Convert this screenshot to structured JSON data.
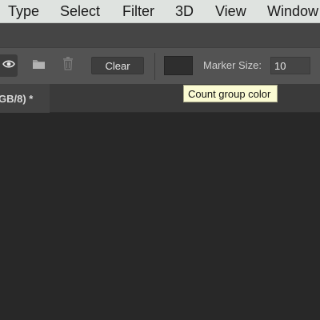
{
  "menubar": {
    "items": [
      "Type",
      "Select",
      "Filter",
      "3D",
      "View",
      "Window"
    ]
  },
  "options_bar": {
    "visibility_icon": "eye-icon",
    "folder_icon": "folder-icon",
    "trash_icon": "trash-icon",
    "clear_label": "Clear",
    "count_group_color": "#2e2e2e",
    "marker_size_label": "Marker Size:",
    "marker_size_value": "10"
  },
  "document_tab": {
    "title_fragment": "GB/8) *"
  },
  "tooltip": {
    "text": "Count group color"
  }
}
